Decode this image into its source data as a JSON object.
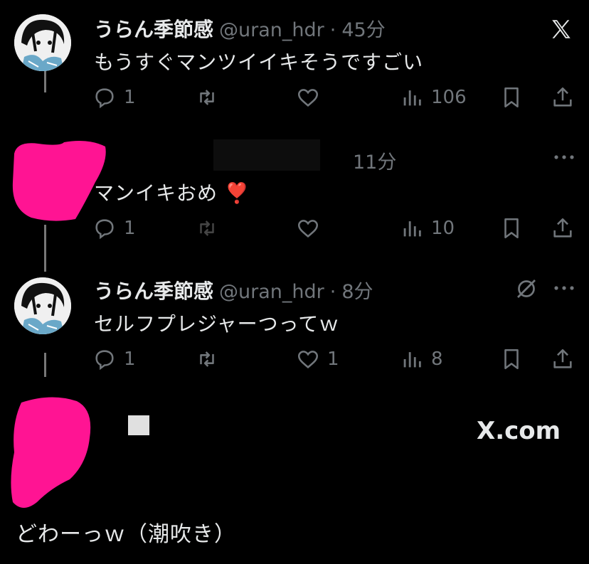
{
  "logo": "X",
  "tweets": [
    {
      "name": "うらん季節感",
      "handle": "@uran_hdr",
      "time": "45分",
      "text": "もうすぐマンツイイキそうですごい",
      "replies": "1",
      "retweets": "",
      "likes": "",
      "views": "106"
    },
    {
      "name": "",
      "handle": "",
      "time": "11分",
      "text": "マンイキおめ ❣️",
      "replies": "1",
      "retweets": "",
      "likes": "",
      "views": "10"
    },
    {
      "name": "うらん季節感",
      "handle": "@uran_hdr",
      "time": "8分",
      "text": "セルフプレジャーつってｗ",
      "replies": "1",
      "retweets": "",
      "likes": "1",
      "views": "8"
    }
  ],
  "footer": {
    "domain": "X.com",
    "caption": "どわーっｗ（潮吹き）"
  },
  "colors": {
    "background": "#000000",
    "text": "#e7e9ea",
    "muted": "#71767b",
    "redaction": "#ff1493"
  }
}
